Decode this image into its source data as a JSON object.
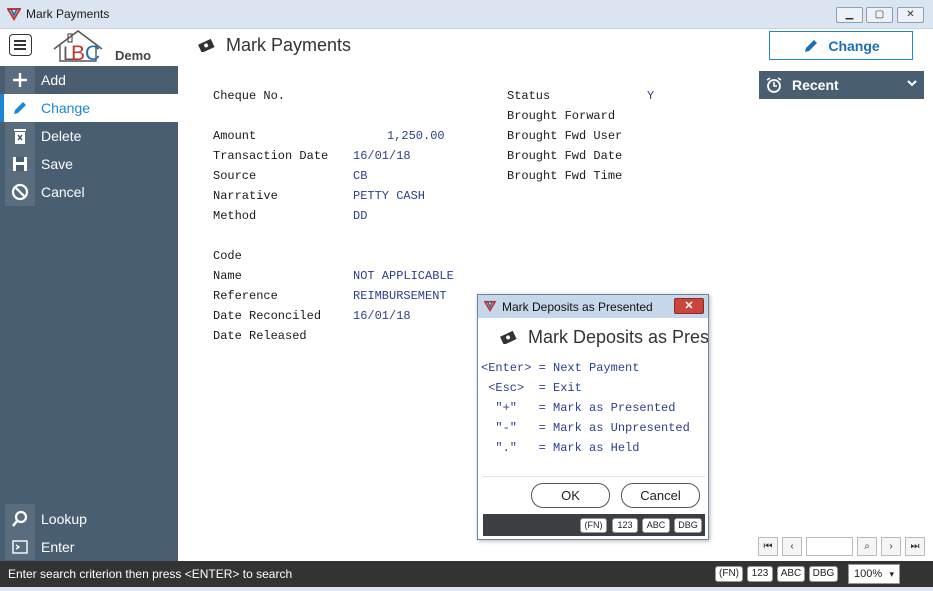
{
  "window": {
    "title": "Mark Payments"
  },
  "header": {
    "logo_demo": "Demo",
    "page_title": "Mark Payments",
    "mode_button": "Change"
  },
  "sidebar": {
    "items": [
      {
        "label": "Add",
        "icon": "plus-icon"
      },
      {
        "label": "Change",
        "icon": "pencil-icon",
        "active": true
      },
      {
        "label": "Delete",
        "icon": "trash-icon"
      },
      {
        "label": "Save",
        "icon": "floppy-icon"
      },
      {
        "label": "Cancel",
        "icon": "cancel-icon"
      }
    ],
    "lower_items": [
      {
        "label": "Lookup",
        "icon": "search-icon"
      },
      {
        "label": "Enter",
        "icon": "enter-icon"
      }
    ]
  },
  "form": {
    "cheque_no_label": "Cheque No.",
    "amount_label": "Amount",
    "amount_value": "1,250.00",
    "transaction_date_label": "Transaction Date",
    "transaction_date_value": "16/01/18",
    "source_label": "Source",
    "source_value": "CB",
    "narrative_label": "Narrative",
    "narrative_value": "PETTY CASH",
    "method_label": "Method",
    "method_value": "DD",
    "code_label": "Code",
    "name_label": "Name",
    "name_value": "NOT APPLICABLE",
    "reference_label": "Reference",
    "reference_value": "REIMBURSEMENT",
    "date_reconciled_label": "Date Reconciled",
    "date_reconciled_value": "16/01/18",
    "date_released_label": "Date Released",
    "status_label": "Status",
    "status_value": "Y",
    "brought_forward_label": "Brought Forward",
    "brought_fwd_user_label": "Brought Fwd User",
    "brought_fwd_date_label": "Brought Fwd Date",
    "brought_fwd_time_label": "Brought Fwd Time"
  },
  "recent": {
    "label": "Recent"
  },
  "dialog": {
    "title": "Mark Deposits as Presented",
    "heading": "Mark Deposits as Presented",
    "lines": [
      "<Enter> = Next Payment",
      " <Esc>  = Exit",
      "  \"+\"   = Mark as Presented",
      "  \"-\"   = Mark as Unpresented",
      "  \".\"   = Mark as Held"
    ],
    "ok_label": "OK",
    "cancel_label": "Cancel",
    "keys": [
      "(FN)",
      "123",
      "ABC",
      "DBG"
    ]
  },
  "statusbar": {
    "message": "Enter search criterion then press <ENTER> to search",
    "keys": [
      "(FN)",
      "123",
      "ABC",
      "DBG"
    ],
    "zoom": "100%"
  },
  "colors": {
    "sidebar_bg": "#4a5e71",
    "accent": "#1d87d6",
    "value_text": "#2d3f8c",
    "status_bar": "#333333"
  }
}
